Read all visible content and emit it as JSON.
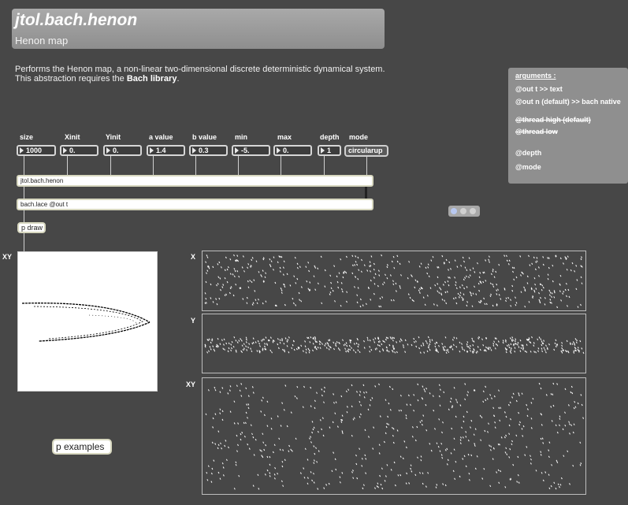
{
  "title": {
    "main": "jtol.bach.henon",
    "subtitle": "Henon map"
  },
  "description": {
    "line1": "Performs the Henon map, a non-linear two-dimensional discrete deterministic dynamical system.",
    "line2_prefix": "This abstraction requires the ",
    "line2_bold": "Bach library",
    "line2_suffix": "."
  },
  "arguments": {
    "heading": "arguments :",
    "out_t": "@out t >> text",
    "out_n": "@out n  (default) >> bach native",
    "thread_high": "@thread high (default)",
    "thread_low": "@thread low",
    "depth": "@depth",
    "mode": "@mode"
  },
  "params": [
    {
      "label": "size",
      "value": "1000"
    },
    {
      "label": "Xinit",
      "value": "0."
    },
    {
      "label": "Yinit",
      "value": "0."
    },
    {
      "label": "a value",
      "value": "1.4"
    },
    {
      "label": "b value",
      "value": "0.3"
    },
    {
      "label": "min",
      "value": "-5."
    },
    {
      "label": "max",
      "value": "0."
    },
    {
      "label": "depth",
      "value": "1"
    },
    {
      "label": "mode",
      "value": "circularup"
    }
  ],
  "objects": {
    "henon": "jtol.bach.henon",
    "lace": "bach.lace @out t",
    "pdraw": "p draw",
    "pexamples": "p examples"
  },
  "plots": {
    "xy_left": "XY",
    "x": "X",
    "y": "Y",
    "xy": "XY"
  },
  "colors": {
    "background": "#474747",
    "title_panel": "#9c9c9c",
    "args_panel": "#8f8f8f"
  }
}
